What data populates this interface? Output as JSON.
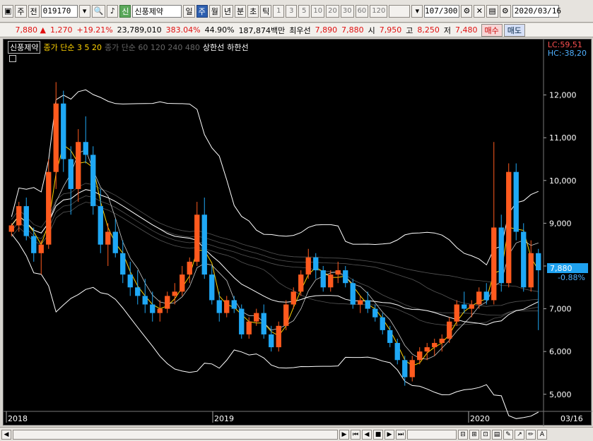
{
  "toolbar": {
    "market": "주",
    "prev_label": "전",
    "code": "019170",
    "sound_icon": "speaker-icon",
    "stock_name": "신풍제약",
    "tabs": [
      "일",
      "주",
      "월",
      "년",
      "분",
      "초",
      "틱"
    ],
    "active_tab": 1,
    "intervals": [
      "1",
      "3",
      "5",
      "10",
      "20",
      "30",
      "60",
      "120"
    ],
    "count": "107",
    "count_total": "/300",
    "date": "2020/03/16"
  },
  "quote": {
    "price": "7,880",
    "change": "1,270",
    "change_pct": "+19.21%",
    "volume": "23,789,010",
    "vol_ratio": "383.04%",
    "turnover": "44.90%",
    "amount": "187,874백만",
    "best_label": "최우선",
    "ask": "7,890",
    "bid": "7,880",
    "open_label": "시",
    "open": "7,950",
    "high_label": "고",
    "high": "8,250",
    "low_label": "저",
    "low": "7,480",
    "buy_label": "매수",
    "sell_label": "매도"
  },
  "legend": {
    "name": "신풍제약",
    "ma": "종가 단순 3  5  20",
    "ma2": "종가 단순 60  120  240  480",
    "upper": "상한선",
    "lower": "하한선"
  },
  "chart_meta": {
    "lc": "LC:59,51",
    "hc": "HC:-38,20",
    "price_tag": "7,880",
    "change_tag": "-0.88%",
    "up_color": "#ff5a1e",
    "down_color": "#1fa8f5",
    "y_ticks": [
      "12,000",
      "11,000",
      "10,000",
      "9,000",
      "8,000",
      "7,000",
      "6,000",
      "5,000"
    ],
    "x_ticks": [
      "2018",
      "2019",
      "2020",
      "03/16"
    ]
  },
  "chart_data": {
    "type": "candlestick",
    "ylim": [
      4600,
      13000
    ],
    "x_axis": [
      "2018",
      "2019",
      "2020"
    ],
    "candles": [
      [
        8800,
        9000,
        8700,
        8950
      ],
      [
        8950,
        9500,
        8800,
        9400
      ],
      [
        9400,
        9600,
        8600,
        8700
      ],
      [
        8700,
        8900,
        8100,
        8300
      ],
      [
        8300,
        8600,
        7800,
        8500
      ],
      [
        8500,
        10500,
        8400,
        10200
      ],
      [
        10200,
        12300,
        9800,
        11800
      ],
      [
        11800,
        12100,
        10200,
        10500
      ],
      [
        10500,
        10800,
        9200,
        9800
      ],
      [
        9800,
        11200,
        9500,
        10900
      ],
      [
        10900,
        11500,
        10400,
        10600
      ],
      [
        10600,
        10800,
        9200,
        9400
      ],
      [
        9400,
        9800,
        8300,
        8500
      ],
      [
        8500,
        9000,
        8000,
        8800
      ],
      [
        8800,
        9100,
        8200,
        8300
      ],
      [
        8300,
        8600,
        7600,
        7800
      ],
      [
        7800,
        8100,
        7300,
        7500
      ],
      [
        7500,
        7900,
        7100,
        7300
      ],
      [
        7300,
        7700,
        6900,
        7100
      ],
      [
        7100,
        7400,
        6700,
        6900
      ],
      [
        6900,
        7200,
        6700,
        7000
      ],
      [
        7000,
        7400,
        6900,
        7300
      ],
      [
        7300,
        7600,
        7100,
        7400
      ],
      [
        7400,
        8000,
        7300,
        7800
      ],
      [
        7800,
        8200,
        7600,
        8100
      ],
      [
        8100,
        9500,
        8000,
        9200
      ],
      [
        9200,
        9600,
        7700,
        7800
      ],
      [
        7800,
        8000,
        7100,
        7200
      ],
      [
        7200,
        7400,
        6700,
        6900
      ],
      [
        6900,
        7300,
        6800,
        7200
      ],
      [
        7200,
        7300,
        6900,
        7000
      ],
      [
        7000,
        7100,
        6300,
        6400
      ],
      [
        6400,
        6800,
        6300,
        6700
      ],
      [
        6700,
        7000,
        6600,
        6900
      ],
      [
        6900,
        7100,
        6300,
        6400
      ],
      [
        6400,
        6600,
        6000,
        6100
      ],
      [
        6100,
        6700,
        6000,
        6600
      ],
      [
        6600,
        7200,
        6500,
        7100
      ],
      [
        7100,
        7500,
        7000,
        7400
      ],
      [
        7400,
        7900,
        7300,
        7800
      ],
      [
        7800,
        8400,
        7700,
        8200
      ],
      [
        8200,
        8300,
        7700,
        7900
      ],
      [
        7900,
        8000,
        7400,
        7500
      ],
      [
        7500,
        7900,
        7400,
        7800
      ],
      [
        7800,
        8100,
        7600,
        7900
      ],
      [
        7900,
        8000,
        7500,
        7600
      ],
      [
        7600,
        7700,
        7000,
        7100
      ],
      [
        7100,
        7300,
        6900,
        7200
      ],
      [
        7200,
        7400,
        6900,
        7000
      ],
      [
        7000,
        7100,
        6700,
        6800
      ],
      [
        6800,
        6900,
        6400,
        6500
      ],
      [
        6500,
        6600,
        6100,
        6200
      ],
      [
        6200,
        6300,
        5700,
        5800
      ],
      [
        5800,
        5900,
        5200,
        5400
      ],
      [
        5400,
        5900,
        5300,
        5800
      ],
      [
        5800,
        6100,
        5700,
        6000
      ],
      [
        6000,
        6200,
        5800,
        6100
      ],
      [
        6100,
        6300,
        5900,
        6200
      ],
      [
        6200,
        6400,
        6000,
        6300
      ],
      [
        6300,
        6800,
        6200,
        6700
      ],
      [
        6700,
        7200,
        6600,
        7100
      ],
      [
        7100,
        7400,
        6900,
        7000
      ],
      [
        7000,
        7200,
        6800,
        7100
      ],
      [
        7100,
        7500,
        7000,
        7400
      ],
      [
        7400,
        7600,
        7100,
        7200
      ],
      [
        7200,
        10900,
        7100,
        8900
      ],
      [
        8900,
        9200,
        7400,
        7600
      ],
      [
        7600,
        10400,
        7500,
        10200
      ],
      [
        10200,
        10400,
        8600,
        8800
      ],
      [
        8800,
        9000,
        7400,
        7500
      ],
      [
        7500,
        8600,
        7400,
        8300
      ],
      [
        8300,
        8400,
        6500,
        7900
      ]
    ]
  }
}
